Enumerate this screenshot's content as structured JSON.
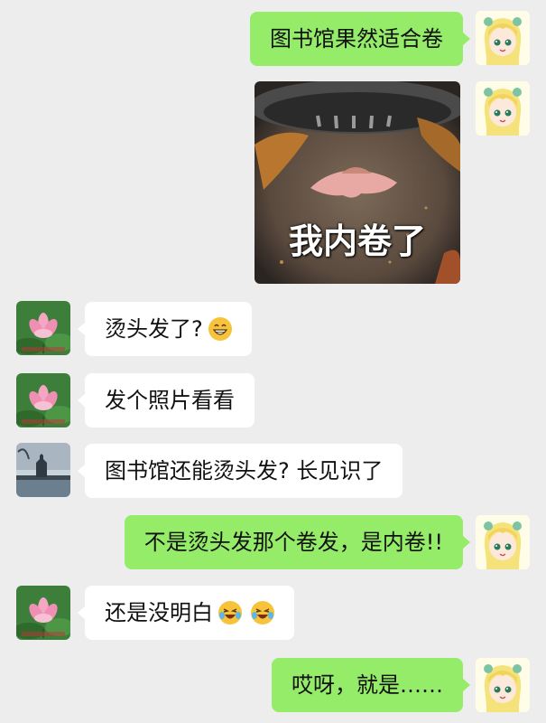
{
  "messages": [
    {
      "text": "图书馆果然适合卷"
    },
    {
      "caption": "我内卷了"
    },
    {
      "text": "烫头发了?"
    },
    {
      "text": "发个照片看看"
    },
    {
      "text": "图书馆还能烫头发? 长见识了"
    },
    {
      "text": "不是烫头发那个卷发，是内卷!!"
    },
    {
      "text": "还是没明白"
    },
    {
      "text": "哎呀，就是……"
    }
  ],
  "icons": [
    "anime-girl-avatar",
    "lotus-avatar",
    "pagoda-lake-avatar",
    "grin-emoji",
    "laughing-tears-emoji"
  ],
  "colors": {
    "background": "#ededed",
    "outgoing_bubble": "#95ec69",
    "incoming_bubble": "#ffffff"
  }
}
